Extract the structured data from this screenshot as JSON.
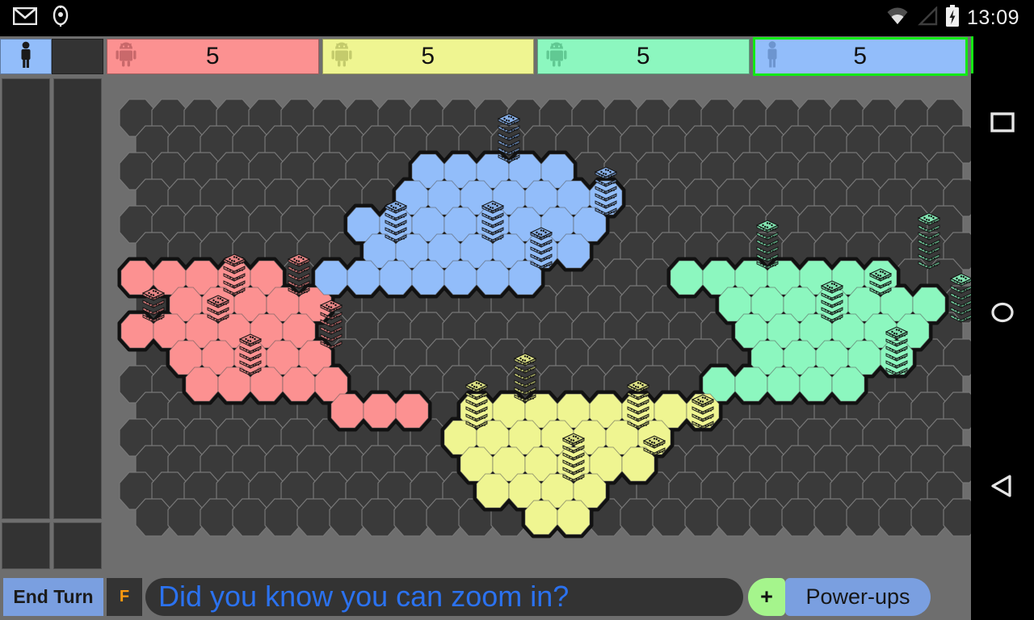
{
  "status_bar": {
    "icons": [
      "mail-icon",
      "android-head-icon",
      "wifi-icon",
      "signal-icon",
      "battery-charging-icon"
    ],
    "clock": "13:09"
  },
  "player_bar": {
    "turn_indicator_icon": "human-figure-icon",
    "players": [
      {
        "name": "Red",
        "icon": "android-robot-icon",
        "score": "5",
        "color": "#fc9191",
        "icon_color": "#c9696b",
        "active": false,
        "type": "ai"
      },
      {
        "name": "Yellow",
        "icon": "android-robot-icon",
        "score": "5",
        "color": "#eff591",
        "icon_color": "#c4cb6c",
        "active": false,
        "type": "ai"
      },
      {
        "name": "Green",
        "icon": "android-robot-icon",
        "score": "5",
        "color": "#8cf7bf",
        "icon_color": "#61c993",
        "active": false,
        "type": "ai"
      },
      {
        "name": "Blue",
        "icon": "human-figure-icon",
        "score": "5",
        "color": "#92bdfa",
        "icon_color": "#6d95cf",
        "active": true,
        "type": "human"
      }
    ],
    "active_border_color": "#13ea13"
  },
  "board": {
    "background_color": "#6e6e6e",
    "empty_hex_color": "#3a3a3a",
    "hex_outline_color": "#777777",
    "territory_border_color": "#111111",
    "hex": {
      "width": 44,
      "height": 46,
      "col_step": 40,
      "row_step": 33
    },
    "grid": {
      "cols": 26,
      "rows": 16
    },
    "territories": [
      {
        "owner": "Red",
        "fill": "#fc9191",
        "cells": [
          [
            0,
            6
          ],
          [
            1,
            6
          ],
          [
            2,
            6
          ],
          [
            3,
            6
          ],
          [
            4,
            6
          ],
          [
            1,
            7
          ],
          [
            2,
            7
          ],
          [
            3,
            7
          ],
          [
            4,
            7
          ],
          [
            5,
            7
          ],
          [
            0,
            8
          ],
          [
            1,
            8
          ],
          [
            2,
            8
          ],
          [
            3,
            8
          ],
          [
            4,
            8
          ],
          [
            5,
            8
          ],
          [
            1,
            9
          ],
          [
            2,
            9
          ],
          [
            3,
            9
          ],
          [
            4,
            9
          ],
          [
            5,
            9
          ],
          [
            2,
            10
          ],
          [
            3,
            10
          ],
          [
            4,
            10
          ],
          [
            5,
            10
          ],
          [
            6,
            10
          ],
          [
            6,
            11
          ],
          [
            7,
            11
          ],
          [
            8,
            11
          ]
        ],
        "dice": [
          {
            "cell": [
              0,
              7
            ],
            "count": 4
          },
          {
            "cell": [
              2,
              7
            ],
            "count": 3
          },
          {
            "cell": [
              3,
              6
            ],
            "count": 5
          },
          {
            "cell": [
              5,
              6
            ],
            "count": 5
          },
          {
            "cell": [
              3,
              9
            ],
            "count": 5
          },
          {
            "cell": [
              6,
              8
            ],
            "count": 6
          }
        ]
      },
      {
        "owner": "Blue",
        "fill": "#92bdfa",
        "cells": [
          [
            9,
            2
          ],
          [
            10,
            2
          ],
          [
            11,
            2
          ],
          [
            12,
            2
          ],
          [
            13,
            2
          ],
          [
            8,
            3
          ],
          [
            9,
            3
          ],
          [
            10,
            3
          ],
          [
            11,
            3
          ],
          [
            12,
            3
          ],
          [
            13,
            3
          ],
          [
            14,
            3
          ],
          [
            7,
            4
          ],
          [
            8,
            4
          ],
          [
            9,
            4
          ],
          [
            10,
            4
          ],
          [
            11,
            4
          ],
          [
            12,
            4
          ],
          [
            13,
            4
          ],
          [
            14,
            4
          ],
          [
            7,
            5
          ],
          [
            8,
            5
          ],
          [
            9,
            5
          ],
          [
            10,
            5
          ],
          [
            11,
            5
          ],
          [
            12,
            5
          ],
          [
            13,
            5
          ],
          [
            6,
            6
          ],
          [
            7,
            6
          ],
          [
            8,
            6
          ],
          [
            9,
            6
          ],
          [
            10,
            6
          ],
          [
            11,
            6
          ],
          [
            12,
            6
          ]
        ],
        "dice": [
          {
            "cell": [
              11,
              1
            ],
            "count": 6
          },
          {
            "cell": [
              8,
              4
            ],
            "count": 5
          },
          {
            "cell": [
              11,
              4
            ],
            "count": 5
          },
          {
            "cell": [
              12,
              5
            ],
            "count": 5
          },
          {
            "cell": [
              14,
              3
            ],
            "count": 6
          }
        ]
      },
      {
        "owner": "Green",
        "fill": "#8cf7bf",
        "cells": [
          [
            17,
            6
          ],
          [
            18,
            6
          ],
          [
            19,
            6
          ],
          [
            20,
            6
          ],
          [
            21,
            6
          ],
          [
            22,
            6
          ],
          [
            23,
            6
          ],
          [
            18,
            7
          ],
          [
            19,
            7
          ],
          [
            20,
            7
          ],
          [
            21,
            7
          ],
          [
            22,
            7
          ],
          [
            23,
            7
          ],
          [
            24,
            7
          ],
          [
            19,
            8
          ],
          [
            20,
            8
          ],
          [
            21,
            8
          ],
          [
            22,
            8
          ],
          [
            23,
            8
          ],
          [
            24,
            8
          ],
          [
            19,
            9
          ],
          [
            20,
            9
          ],
          [
            21,
            9
          ],
          [
            22,
            9
          ],
          [
            23,
            9
          ],
          [
            18,
            10
          ],
          [
            19,
            10
          ],
          [
            20,
            10
          ],
          [
            21,
            10
          ],
          [
            22,
            10
          ]
        ],
        "dice": [
          {
            "cell": [
              19,
              5
            ],
            "count": 6
          },
          {
            "cell": [
              21,
              7
            ],
            "count": 5
          },
          {
            "cell": [
              23,
              6
            ],
            "count": 3
          },
          {
            "cell": [
              24,
              5
            ],
            "count": 7
          },
          {
            "cell": [
              25,
              7
            ],
            "count": 6
          },
          {
            "cell": [
              23,
              9
            ],
            "count": 6
          }
        ]
      },
      {
        "owner": "Yellow",
        "fill": "#eff591",
        "cells": [
          [
            10,
            11
          ],
          [
            11,
            11
          ],
          [
            12,
            11
          ],
          [
            13,
            11
          ],
          [
            14,
            11
          ],
          [
            15,
            11
          ],
          [
            16,
            11
          ],
          [
            17,
            11
          ],
          [
            10,
            12
          ],
          [
            11,
            12
          ],
          [
            12,
            12
          ],
          [
            13,
            12
          ],
          [
            14,
            12
          ],
          [
            15,
            12
          ],
          [
            16,
            12
          ],
          [
            10,
            13
          ],
          [
            11,
            13
          ],
          [
            12,
            13
          ],
          [
            13,
            13
          ],
          [
            14,
            13
          ],
          [
            15,
            13
          ],
          [
            11,
            14
          ],
          [
            12,
            14
          ],
          [
            13,
            14
          ],
          [
            14,
            14
          ],
          [
            12,
            15
          ],
          [
            13,
            15
          ]
        ],
        "dice": [
          {
            "cell": [
              10,
              11
            ],
            "count": 6
          },
          {
            "cell": [
              12,
              10
            ],
            "count": 6
          },
          {
            "cell": [
              15,
              11
            ],
            "count": 6
          },
          {
            "cell": [
              17,
              11
            ],
            "count": 4
          },
          {
            "cell": [
              16,
              12
            ],
            "count": 2
          },
          {
            "cell": [
              13,
              13
            ],
            "count": 6
          }
        ]
      }
    ]
  },
  "bottom_bar": {
    "end_turn_label": "End Turn",
    "f_button_label": "F",
    "message": "Did you know you can zoom in?",
    "plus_label": "+",
    "powerups_label": "Power-ups",
    "message_color": "#2b72f0"
  },
  "nav_bar": {
    "buttons": [
      {
        "name": "recents-button",
        "icon": "square-icon"
      },
      {
        "name": "home-button",
        "icon": "circle-icon"
      },
      {
        "name": "back-button",
        "icon": "triangle-left-icon"
      }
    ]
  }
}
